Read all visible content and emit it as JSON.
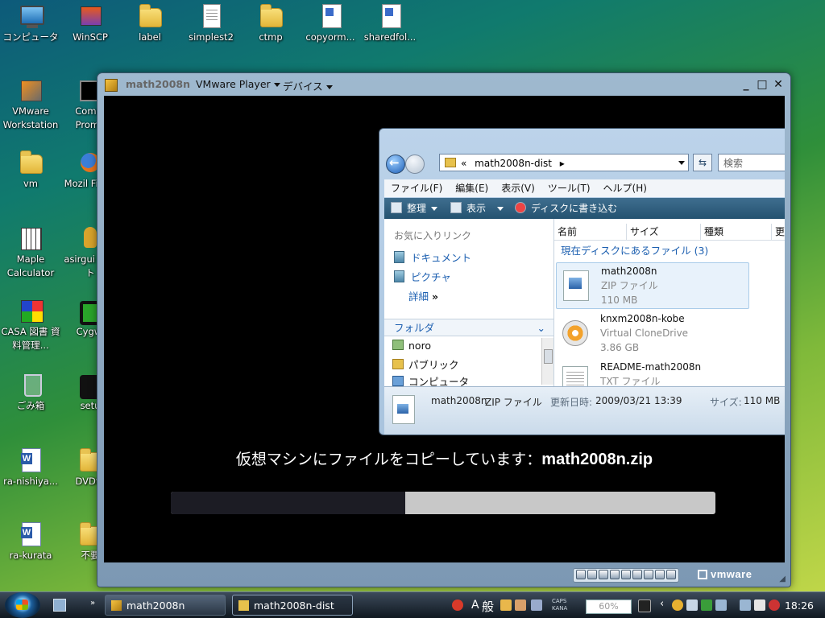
{
  "desktop": {
    "icons": [
      {
        "label": "コンピュータ"
      },
      {
        "label": "WinSCP"
      },
      {
        "label": "label"
      },
      {
        "label": "simplest2"
      },
      {
        "label": "ctmp"
      },
      {
        "label": "copyorm..."
      },
      {
        "label": "sharedfol..."
      },
      {
        "label": "VMware Workstation"
      },
      {
        "label": "Comm Promp"
      },
      {
        "label": "vm"
      },
      {
        "label": "Mozil Firefo"
      },
      {
        "label": "Maple Calculator"
      },
      {
        "label": "asirgui ョート"
      },
      {
        "label": "CASA 図書 資料管理..."
      },
      {
        "label": "Cygwi"
      },
      {
        "label": "ごみ箱"
      },
      {
        "label": "setu"
      },
      {
        "label": "ra-nishiya..."
      },
      {
        "label": "DVDto"
      },
      {
        "label": "ra-kurata"
      },
      {
        "label": "不要"
      }
    ]
  },
  "vmware": {
    "title": "math2008n",
    "menu_player": "VMware Player",
    "menu_devices": "デバイス",
    "copy_message_prefix": "仮想マシンにファイルをコピーしています：",
    "copy_filename": "math2008n.zip",
    "progress": 0.43,
    "brand": "vmware"
  },
  "explorer": {
    "address_prefix": "«",
    "address": "math2008n-dist",
    "search_placeholder": "検索",
    "menu": [
      "ファイル(F)",
      "編集(E)",
      "表示(V)",
      "ツール(T)",
      "ヘルプ(H)"
    ],
    "commands": {
      "organize": "整理",
      "views": "表示",
      "burn": "ディスクに書き込む"
    },
    "favorites_header": "お気に入りリンク",
    "favorites": [
      "ドキュメント",
      "ピクチャ"
    ],
    "more": "詳細",
    "folders_header": "フォルダ",
    "tree": [
      "noro",
      "パブリック",
      "コンピュータ"
    ],
    "columns": [
      "名前",
      "サイズ",
      "種類",
      "更新日時"
    ],
    "group_header": "現在ディスクにあるファイル (3)",
    "files": [
      {
        "name": "math2008n",
        "type": "ZIP ファイル",
        "size": "110 MB"
      },
      {
        "name": "knxm2008n-kobe",
        "type": "Virtual CloneDrive",
        "size": "3.86 GB"
      },
      {
        "name": "README-math2008n",
        "type": "TXT ファイル",
        "size": ""
      }
    ],
    "details": {
      "name": "math2008n",
      "type": "ZIP ファイル",
      "modified_label": "更新日時:",
      "modified": "2009/03/21 13:39",
      "size_label": "サイズ:",
      "size": "110 MB"
    }
  },
  "taskbar": {
    "buttons": [
      "math2008n",
      "math2008n-dist"
    ],
    "ime_mode": "A",
    "ime_kanji": "般",
    "caps": "CAPS",
    "kana": "KANA",
    "zoom": "60%",
    "clock": "18:26"
  },
  "colors": {
    "accent": "#1c5fb0",
    "progress_fill": "#1c1c24",
    "progress_track": "#c8c8c8"
  }
}
